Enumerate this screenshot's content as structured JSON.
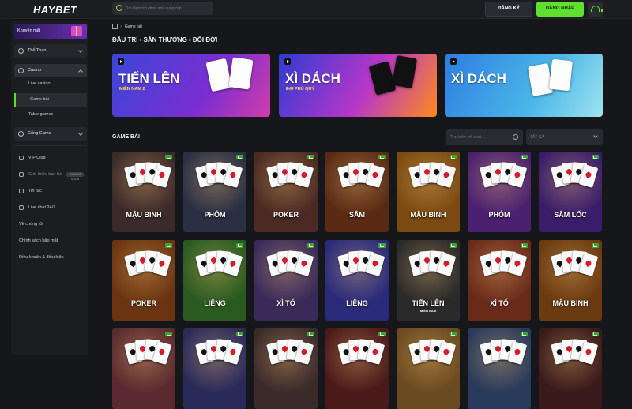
{
  "header": {
    "logo_text": "HAYBET",
    "search_placeholder": "Tìm kiếm trò chơi, nhà cung cấp",
    "register_label": "ĐĂNG KÝ",
    "login_label": "ĐĂNG NHẬP",
    "support_icon": "headset-icon",
    "accent_color": "#5fe02e"
  },
  "sidebar": {
    "promo_label": "Khuyến mãi",
    "sports_label": "Thể Thao",
    "casino_label": "Casino",
    "casino_sub": [
      "Live casino",
      "Game bài",
      "Table games"
    ],
    "portal_label": "Cổng Game",
    "links": [
      "VIP Club",
      "Giới thiệu bạn bè",
      "Tin tức",
      "Live chat 24/7"
    ],
    "referral_badge": "COMING SOON",
    "footer_links": [
      "Về chúng tôi",
      "Chính sách bảo mật",
      "Điều khoản & điều kiện"
    ]
  },
  "breadcrumb": {
    "current": "Game bài"
  },
  "section_title": "ĐẤU TRÍ - SẴN THƯỞNG - ĐỔI ĐỜI",
  "banners": [
    {
      "title": "TIẾN LÊN",
      "subtitle": "MIỀN NAM 2"
    },
    {
      "title": "XÌ DÁCH",
      "subtitle": "ĐẠI PHÚ QUÝ"
    },
    {
      "title": "XÌ DÁCH",
      "subtitle": ""
    }
  ],
  "games_title": "GAME BÀI",
  "filter": {
    "search_placeholder": "Tìm kiếm trò chơi...",
    "select_value": "TẤT CẢ"
  },
  "games": [
    {
      "name": "MẬU BINH",
      "bg": "#3b2a2a"
    },
    {
      "name": "PHỎM",
      "bg": "#2a2f44"
    },
    {
      "name": "POKER",
      "bg": "#4a2a22"
    },
    {
      "name": "SÂM",
      "bg": "#5a2a14"
    },
    {
      "name": "MẬU BINH",
      "bg": "#7a4a10"
    },
    {
      "name": "PHỎM",
      "bg": "#4a2070"
    },
    {
      "name": "SÂM LỐC",
      "bg": "#3a1d6a"
    },
    {
      "name": "POKER",
      "bg": "#6a3410"
    },
    {
      "name": "LIÊNG",
      "bg": "#2a5a20"
    },
    {
      "name": "XÌ TỐ",
      "bg": "#3a2a5a"
    },
    {
      "name": "LIÊNG",
      "bg": "#2a2a7a"
    },
    {
      "name": "TIẾN LÊN",
      "sub": "MIỀN NAM",
      "bg": "#2a2a2a"
    },
    {
      "name": "XÌ TỐ",
      "bg": "#6a2a1a"
    },
    {
      "name": "MẬU BINH",
      "bg": "#6a3a10"
    },
    {
      "name": "",
      "bg": "#5a2a30"
    },
    {
      "name": "",
      "bg": "#2a2a5a"
    },
    {
      "name": "",
      "bg": "#3a2a2a"
    },
    {
      "name": "",
      "bg": "#4a1a1a"
    },
    {
      "name": "",
      "bg": "#6a4a20"
    },
    {
      "name": "",
      "bg": "#2a3a5a"
    },
    {
      "name": "",
      "bg": "#3a1a1a"
    }
  ]
}
